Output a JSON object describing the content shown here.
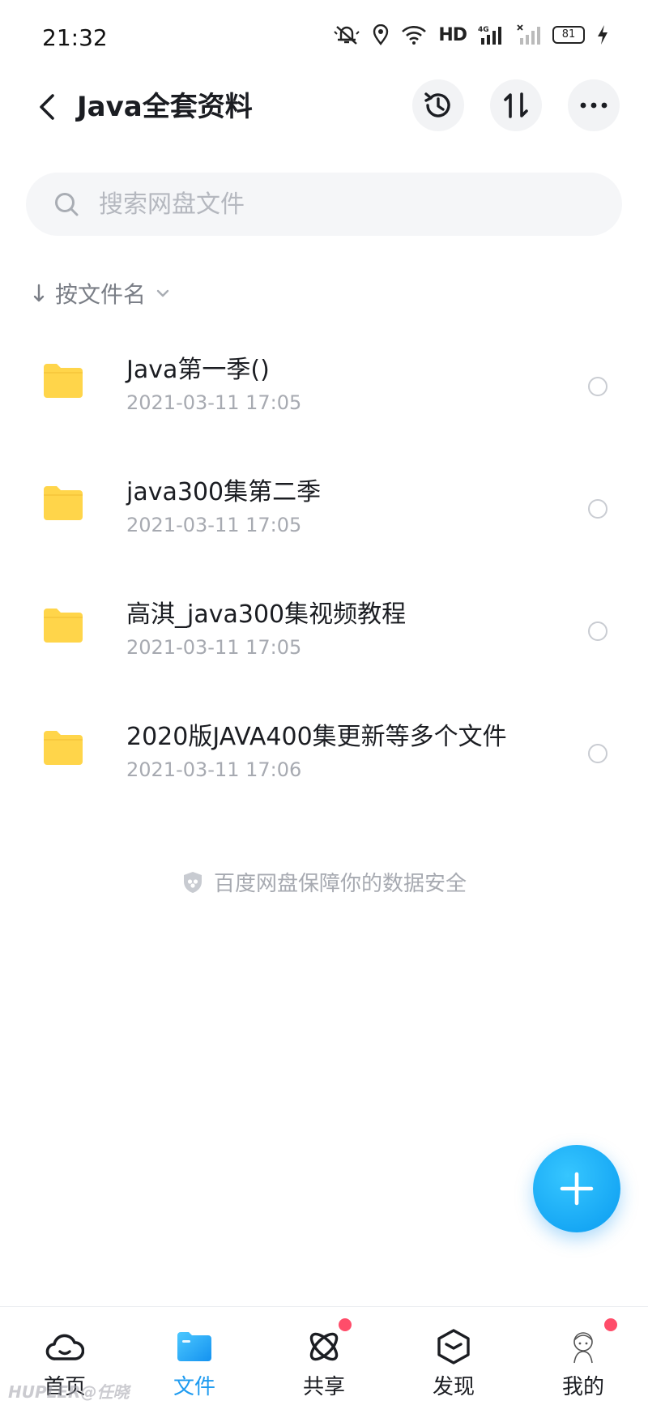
{
  "status_bar": {
    "time": "21:32",
    "network_label": "HD",
    "signal_label": "4G",
    "battery": "81"
  },
  "header": {
    "title": "Java全套资料"
  },
  "search": {
    "placeholder": "搜索网盘文件"
  },
  "sort": {
    "label": "按文件名"
  },
  "files": [
    {
      "name": "Java第一季()",
      "date": "2021-03-11  17:05"
    },
    {
      "name": "java300集第二季",
      "date": "2021-03-11  17:05"
    },
    {
      "name": "高淇_java300集视频教程",
      "date": "2021-03-11  17:05"
    },
    {
      "name": "2020版JAVA400集更新等多个文件",
      "date": "2021-03-11  17:06"
    }
  ],
  "security_note": "百度网盘保障你的数据安全",
  "bottom_nav": {
    "items": [
      {
        "label": "首页",
        "icon": "cloud-home-icon"
      },
      {
        "label": "文件",
        "icon": "folder-icon",
        "active": true
      },
      {
        "label": "共享",
        "icon": "atom-share-icon"
      },
      {
        "label": "发现",
        "icon": "cube-discover-icon"
      },
      {
        "label": "我的",
        "icon": "avatar-icon"
      }
    ]
  },
  "watermark": "HUPLER@任晓",
  "colors": {
    "accent": "#1e9bf0",
    "folder": "#ffd54a",
    "badge": "#ff4d6a"
  }
}
